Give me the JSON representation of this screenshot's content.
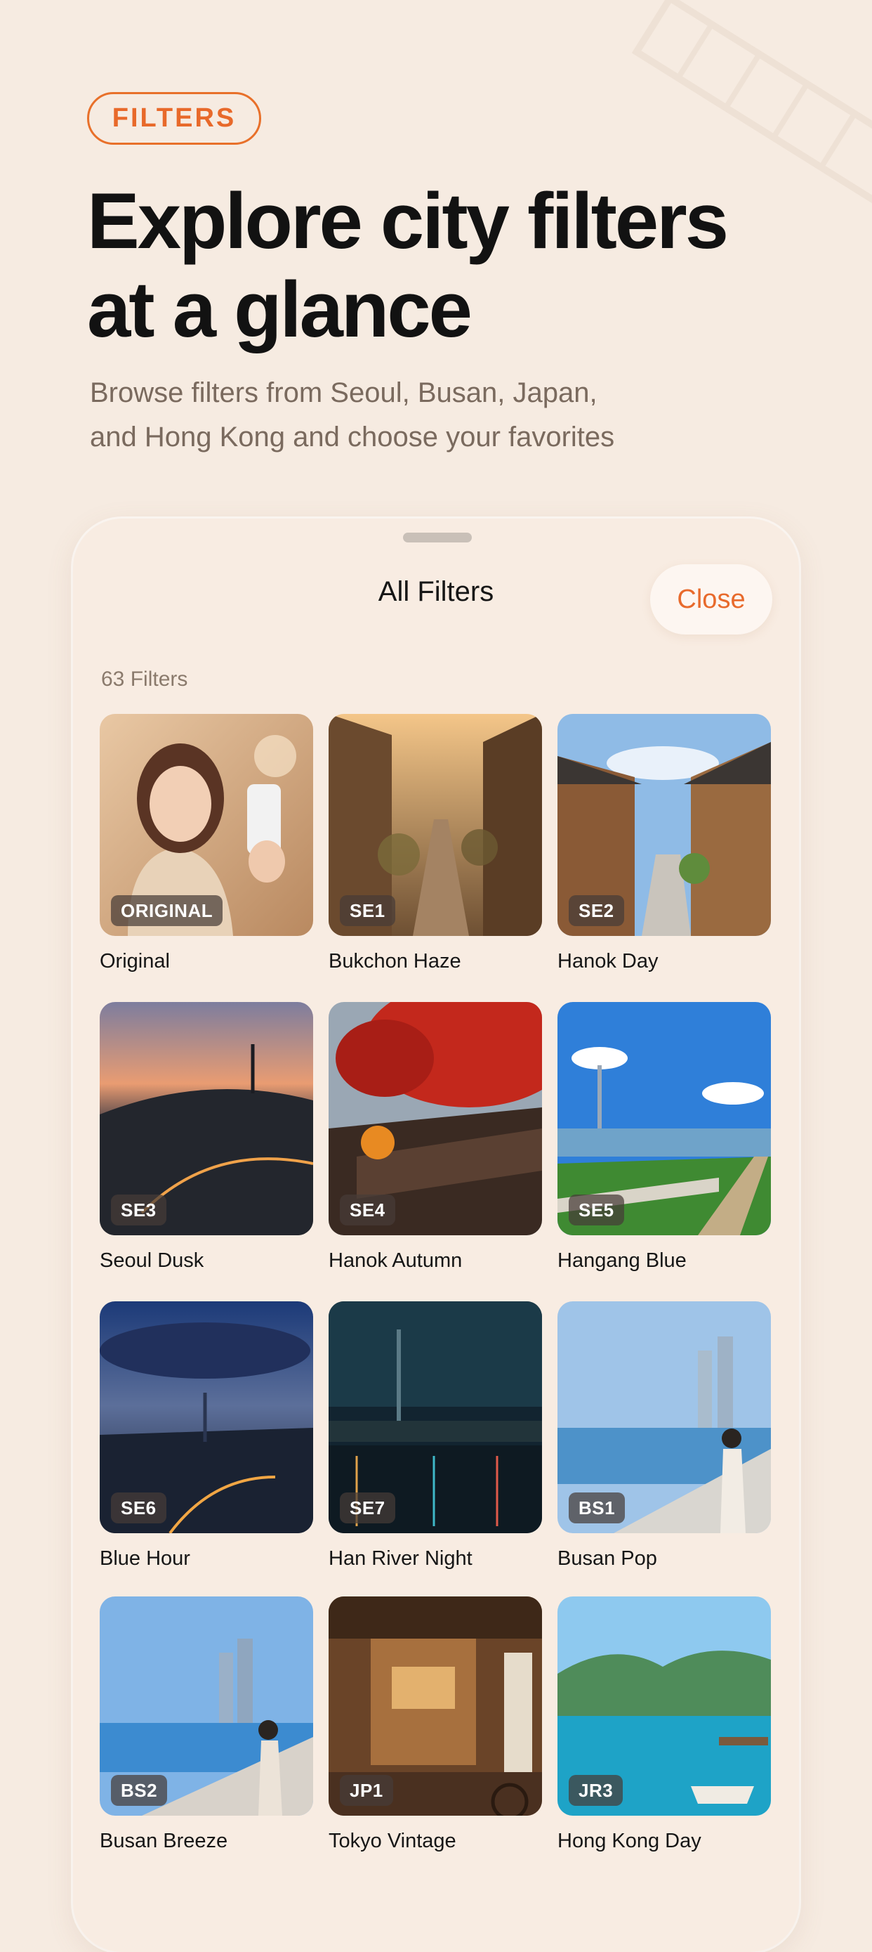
{
  "header": {
    "pill_label": "FILTERS",
    "headline_line1": "Explore city filters",
    "headline_line2": "at a glance",
    "subtitle_line1": "Browse filters from Seoul, Busan, Japan,",
    "subtitle_line2": "and Hong Kong and choose your favorites"
  },
  "sheet": {
    "title": "All Filters",
    "close_label": "Close",
    "count_label": "63 Filters"
  },
  "filters": [
    {
      "code": "ORIGINAL",
      "name": "Original"
    },
    {
      "code": "SE1",
      "name": "Bukchon Haze"
    },
    {
      "code": "SE2",
      "name": "Hanok Day"
    },
    {
      "code": "SE3",
      "name": "Seoul Dusk"
    },
    {
      "code": "SE4",
      "name": "Hanok Autumn"
    },
    {
      "code": "SE5",
      "name": "Hangang Blue"
    },
    {
      "code": "SE6",
      "name": "Blue Hour"
    },
    {
      "code": "SE7",
      "name": "Han River Night"
    },
    {
      "code": "BS1",
      "name": "Busan Pop"
    },
    {
      "code": "BS2",
      "name": "Busan Breeze"
    },
    {
      "code": "JP1",
      "name": "Tokyo Vintage"
    },
    {
      "code": "JR3",
      "name": "Hong Kong Day"
    }
  ],
  "colors": {
    "accent": "#e8702a",
    "background": "#f6ebe1"
  }
}
